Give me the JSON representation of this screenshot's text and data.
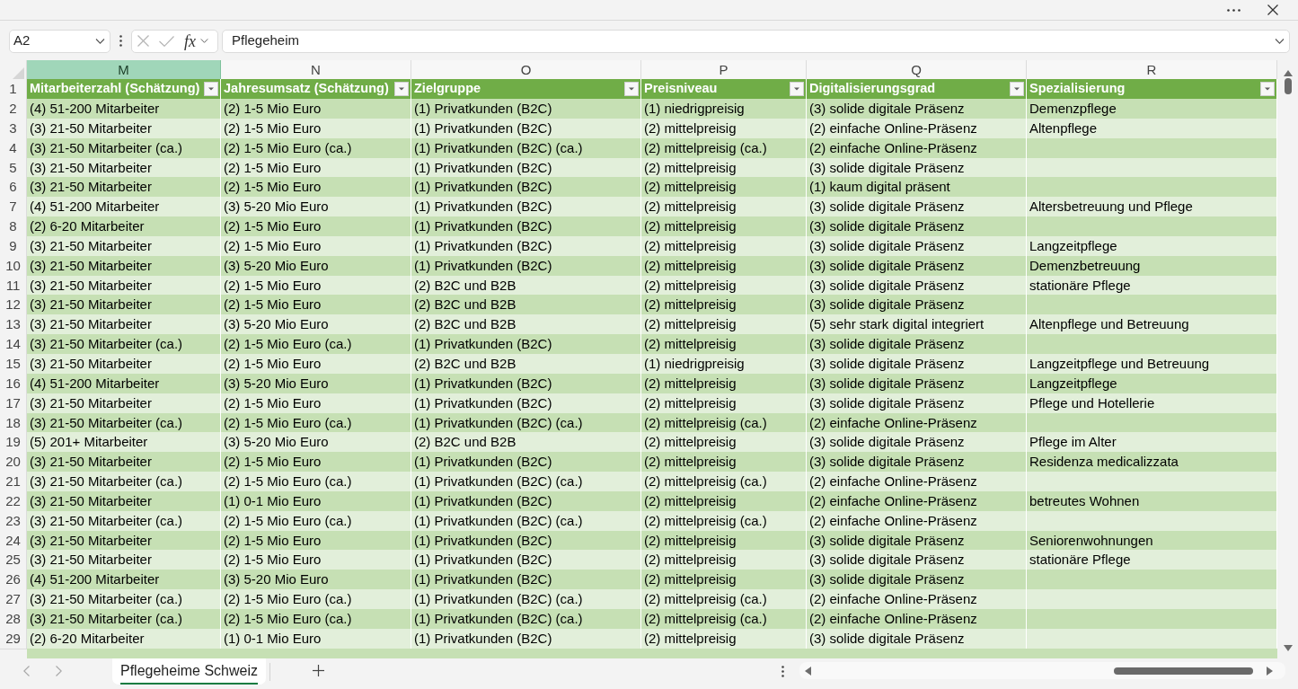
{
  "formula_bar": {
    "name_box": "A2",
    "function_label": "fx",
    "formula": "Pflegeheim"
  },
  "columns": [
    {
      "letter": "M",
      "selected": true
    },
    {
      "letter": "N",
      "selected": false
    },
    {
      "letter": "O",
      "selected": false
    },
    {
      "letter": "P",
      "selected": false
    },
    {
      "letter": "Q",
      "selected": false
    },
    {
      "letter": "R",
      "selected": false
    }
  ],
  "table": {
    "header_row_number": "1",
    "headers": [
      "Mitarbeiterzahl (Schätzung)",
      "Jahresumsatz (Schätzung)",
      "Zielgruppe",
      "Preisniveau",
      "Digitalisierungsgrad",
      "Spezialisierung"
    ],
    "rows": [
      {
        "number": "2",
        "cells": [
          "(4) 51-200 Mitarbeiter",
          "(2) 1-5 Mio Euro",
          "(1) Privatkunden (B2C)",
          "(1) niedrigpreisig",
          "(3) solide digitale Präsenz",
          "Demenzpflege"
        ]
      },
      {
        "number": "3",
        "cells": [
          "(3) 21-50 Mitarbeiter",
          "(2) 1-5 Mio Euro",
          "(1) Privatkunden (B2C)",
          "(2) mittelpreisig",
          "(2) einfache Online-Präsenz",
          "Altenpflege"
        ]
      },
      {
        "number": "4",
        "cells": [
          "(3) 21-50 Mitarbeiter (ca.)",
          "(2) 1-5 Mio Euro (ca.)",
          "(1) Privatkunden (B2C) (ca.)",
          "(2) mittelpreisig (ca.)",
          "(2) einfache Online-Präsenz"
        ]
      },
      {
        "number": "5",
        "cells": [
          "(3) 21-50 Mitarbeiter",
          "(2) 1-5 Mio Euro",
          "(1) Privatkunden (B2C)",
          "(2) mittelpreisig",
          "(3) solide digitale Präsenz"
        ]
      },
      {
        "number": "6",
        "cells": [
          "(3) 21-50 Mitarbeiter",
          "(2) 1-5 Mio Euro",
          "(1) Privatkunden (B2C)",
          "(2) mittelpreisig",
          "(1) kaum digital präsent"
        ]
      },
      {
        "number": "7",
        "cells": [
          "(4) 51-200 Mitarbeiter",
          "(3) 5-20 Mio Euro",
          "(1) Privatkunden (B2C)",
          "(2) mittelpreisig",
          "(3) solide digitale Präsenz",
          "Altersbetreuung und Pflege"
        ]
      },
      {
        "number": "8",
        "cells": [
          "(2) 6-20 Mitarbeiter",
          "(2) 1-5 Mio Euro",
          "(1) Privatkunden (B2C)",
          "(2) mittelpreisig",
          "(3) solide digitale Präsenz"
        ]
      },
      {
        "number": "9",
        "cells": [
          "(3) 21-50 Mitarbeiter",
          "(2) 1-5 Mio Euro",
          "(1) Privatkunden (B2C)",
          "(2) mittelpreisig",
          "(3) solide digitale Präsenz",
          "Langzeitpflege"
        ]
      },
      {
        "number": "10",
        "cells": [
          "(3) 21-50 Mitarbeiter",
          "(3) 5-20 Mio Euro",
          "(1) Privatkunden (B2C)",
          "(2) mittelpreisig",
          "(3) solide digitale Präsenz",
          "Demenzbetreuung"
        ]
      },
      {
        "number": "11",
        "cells": [
          "(3) 21-50 Mitarbeiter",
          "(2) 1-5 Mio Euro",
          "(2) B2C und B2B",
          "(2) mittelpreisig",
          "(3) solide digitale Präsenz",
          "stationäre Pflege"
        ]
      },
      {
        "number": "12",
        "cells": [
          "(3) 21-50 Mitarbeiter",
          "(2) 1-5 Mio Euro",
          "(2) B2C und B2B",
          "(2) mittelpreisig",
          "(3) solide digitale Präsenz"
        ]
      },
      {
        "number": "13",
        "cells": [
          "(3) 21-50 Mitarbeiter",
          "(3) 5-20 Mio Euro",
          "(2) B2C und B2B",
          "(2) mittelpreisig",
          "(5) sehr stark digital integriert",
          "Altenpflege und Betreuung"
        ]
      },
      {
        "number": "14",
        "cells": [
          "(3) 21-50 Mitarbeiter (ca.)",
          "(2) 1-5 Mio Euro (ca.)",
          "(1) Privatkunden (B2C)",
          "(2) mittelpreisig",
          "(3) solide digitale Präsenz"
        ]
      },
      {
        "number": "15",
        "cells": [
          "(3) 21-50 Mitarbeiter",
          "(2) 1-5 Mio Euro",
          "(2) B2C und B2B",
          "(1) niedrigpreisig",
          "(3) solide digitale Präsenz",
          "Langzeitpflege und Betreuung"
        ]
      },
      {
        "number": "16",
        "cells": [
          "(4) 51-200 Mitarbeiter",
          "(3) 5-20 Mio Euro",
          "(1) Privatkunden (B2C)",
          "(2) mittelpreisig",
          "(3) solide digitale Präsenz",
          "Langzeitpflege"
        ]
      },
      {
        "number": "17",
        "cells": [
          "(3) 21-50 Mitarbeiter",
          "(2) 1-5 Mio Euro",
          "(1) Privatkunden (B2C)",
          "(2) mittelpreisig",
          "(3) solide digitale Präsenz",
          "Pflege und Hotellerie"
        ]
      },
      {
        "number": "18",
        "cells": [
          "(3) 21-50 Mitarbeiter (ca.)",
          "(2) 1-5 Mio Euro (ca.)",
          "(1) Privatkunden (B2C) (ca.)",
          "(2) mittelpreisig (ca.)",
          "(2) einfache Online-Präsenz"
        ]
      },
      {
        "number": "19",
        "cells": [
          "(5) 201+ Mitarbeiter",
          "(3) 5-20 Mio Euro",
          "(2) B2C und B2B",
          "(2) mittelpreisig",
          "(3) solide digitale Präsenz",
          "Pflege im Alter"
        ]
      },
      {
        "number": "20",
        "cells": [
          "(3) 21-50 Mitarbeiter",
          "(2) 1-5 Mio Euro",
          "(1) Privatkunden (B2C)",
          "(2) mittelpreisig",
          "(3) solide digitale Präsenz",
          "Residenza medicalizzata"
        ]
      },
      {
        "number": "21",
        "cells": [
          "(3) 21-50 Mitarbeiter (ca.)",
          "(2) 1-5 Mio Euro (ca.)",
          "(1) Privatkunden (B2C) (ca.)",
          "(2) mittelpreisig (ca.)",
          "(2) einfache Online-Präsenz"
        ]
      },
      {
        "number": "22",
        "cells": [
          "(3) 21-50 Mitarbeiter",
          "(1) 0-1 Mio Euro",
          "(1) Privatkunden (B2C)",
          "(2) mittelpreisig",
          "(2) einfache Online-Präsenz",
          "betreutes Wohnen"
        ]
      },
      {
        "number": "23",
        "cells": [
          "(3) 21-50 Mitarbeiter (ca.)",
          "(2) 1-5 Mio Euro (ca.)",
          "(1) Privatkunden (B2C) (ca.)",
          "(2) mittelpreisig (ca.)",
          "(2) einfache Online-Präsenz"
        ]
      },
      {
        "number": "24",
        "cells": [
          "(3) 21-50 Mitarbeiter",
          "(2) 1-5 Mio Euro",
          "(1) Privatkunden (B2C)",
          "(2) mittelpreisig",
          "(3) solide digitale Präsenz",
          "Seniorenwohnungen"
        ]
      },
      {
        "number": "25",
        "cells": [
          "(3) 21-50 Mitarbeiter",
          "(2) 1-5 Mio Euro",
          "(1) Privatkunden (B2C)",
          "(2) mittelpreisig",
          "(3) solide digitale Präsenz",
          "stationäre Pflege"
        ]
      },
      {
        "number": "26",
        "cells": [
          "(4) 51-200 Mitarbeiter",
          "(3) 5-20 Mio Euro",
          "(1) Privatkunden (B2C)",
          "(2) mittelpreisig",
          "(3) solide digitale Präsenz"
        ]
      },
      {
        "number": "27",
        "cells": [
          "(3) 21-50 Mitarbeiter (ca.)",
          "(2) 1-5 Mio Euro (ca.)",
          "(1) Privatkunden (B2C) (ca.)",
          "(2) mittelpreisig (ca.)",
          "(2) einfache Online-Präsenz"
        ]
      },
      {
        "number": "28",
        "cells": [
          "(3) 21-50 Mitarbeiter (ca.)",
          "(2) 1-5 Mio Euro (ca.)",
          "(1) Privatkunden (B2C) (ca.)",
          "(2) mittelpreisig (ca.)",
          "(2) einfache Online-Präsenz"
        ]
      },
      {
        "number": "29",
        "cells": [
          "(2) 6-20 Mitarbeiter",
          "(1) 0-1 Mio Euro",
          "(1) Privatkunden (B2C)",
          "(2) mittelpreisig",
          "(3) solide digitale Präsenz"
        ]
      }
    ]
  },
  "sheet_tabs": [
    {
      "label": "Pflegeheime Schweiz",
      "selected": true
    }
  ]
}
